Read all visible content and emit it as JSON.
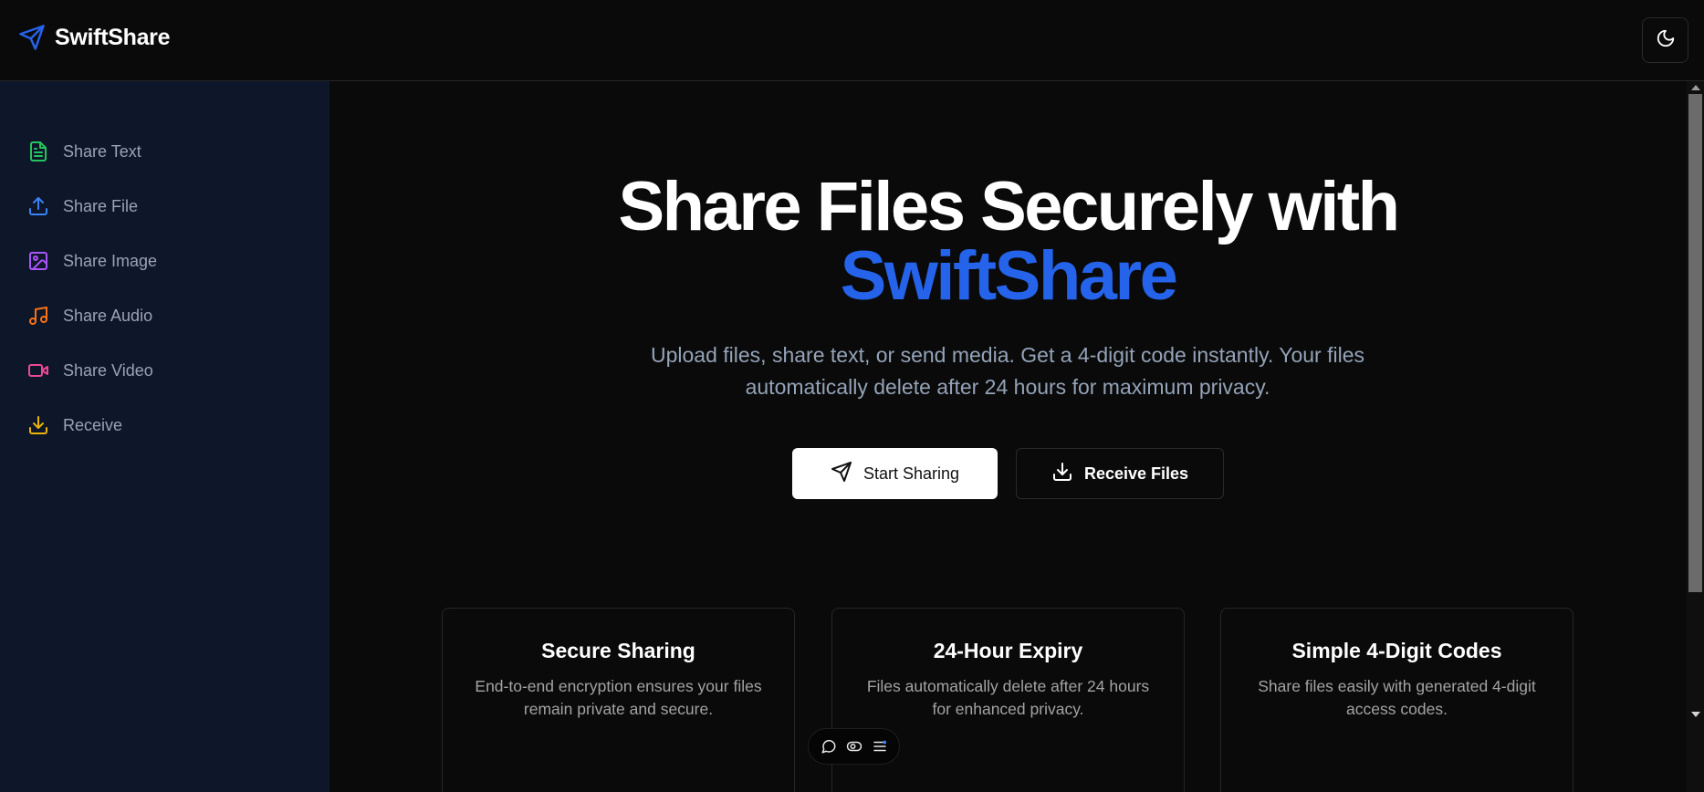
{
  "header": {
    "brand_name": "SwiftShare",
    "brand_icon": "send-icon",
    "theme_toggle_icon": "moon-icon"
  },
  "sidebar": {
    "items": [
      {
        "label": "Share Text",
        "icon": "file-text-icon",
        "color": "#22c55e"
      },
      {
        "label": "Share File",
        "icon": "upload-icon",
        "color": "#3b82f6"
      },
      {
        "label": "Share Image",
        "icon": "image-icon",
        "color": "#a855f7"
      },
      {
        "label": "Share Audio",
        "icon": "music-icon",
        "color": "#f97316"
      },
      {
        "label": "Share Video",
        "icon": "video-icon",
        "color": "#ec4899"
      },
      {
        "label": "Receive",
        "icon": "download-icon",
        "color": "#eab308"
      }
    ]
  },
  "hero": {
    "title_line1": "Share Files Securely with",
    "title_line2": "SwiftShare",
    "subtitle": "Upload files, share text, or send media. Get a 4-digit code instantly. Your files automatically delete after 24 hours for maximum privacy.",
    "primary_button": "Start Sharing",
    "secondary_button": "Receive Files"
  },
  "features": [
    {
      "title": "Secure Sharing",
      "text": "End-to-end encryption ensures your files remain private and secure."
    },
    {
      "title": "24-Hour Expiry",
      "text": "Files automatically delete after 24 hours for enhanced privacy."
    },
    {
      "title": "Simple 4-Digit Codes",
      "text": "Share files easily with generated 4-digit access codes."
    }
  ],
  "toolbar": {
    "icons": [
      "comment-icon",
      "toggle-icon",
      "list-icon"
    ]
  },
  "colors": {
    "accent": "#2563eb",
    "background": "#0a0a0a",
    "sidebar_bg": "#0e1629"
  }
}
